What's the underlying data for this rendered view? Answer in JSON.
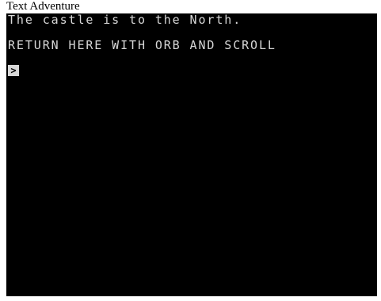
{
  "window": {
    "title": "Text Adventure"
  },
  "screen": {
    "lines": [
      "The castle is to the North.",
      "RETURN HERE WITH ORB AND SCROLL"
    ],
    "prompt": ">"
  },
  "colors": {
    "background": "#000000",
    "text": "#d7d7d7",
    "page": "#ffffff"
  }
}
